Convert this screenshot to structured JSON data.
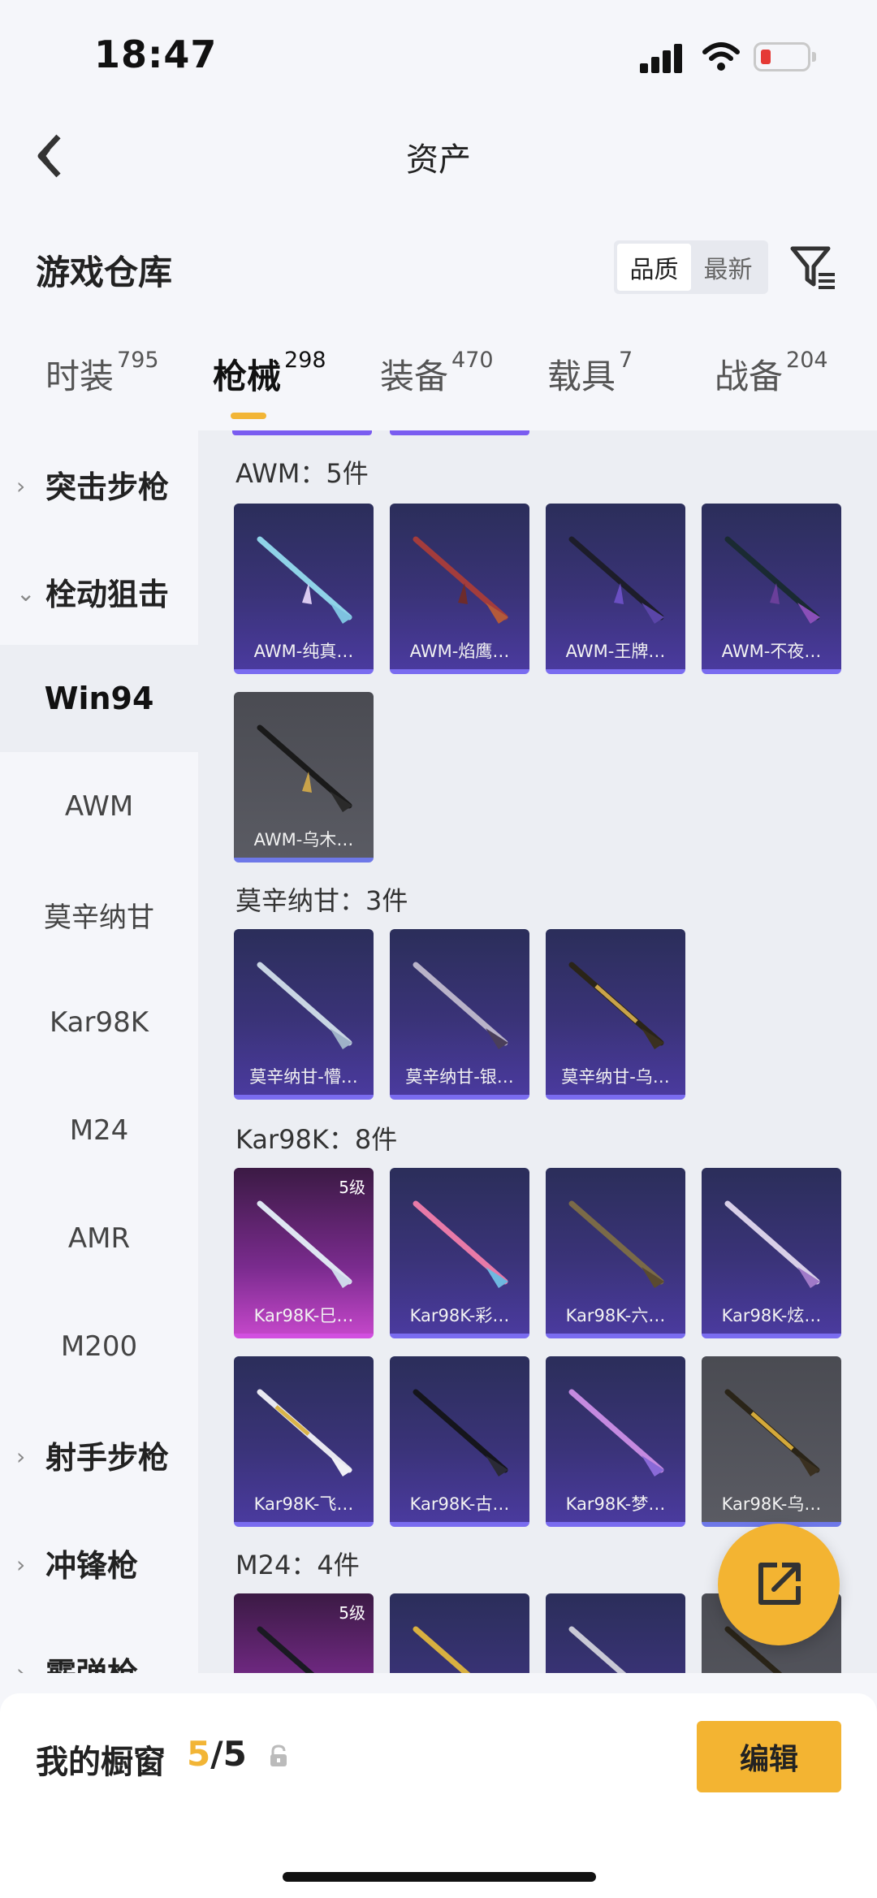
{
  "status_bar": {
    "time": "18:47"
  },
  "nav": {
    "title": "资产"
  },
  "header": {
    "title": "游戏仓库",
    "sort_options": [
      {
        "label": "品质",
        "active": true
      },
      {
        "label": "最新",
        "active": false
      }
    ]
  },
  "tabs": [
    {
      "label": "时装",
      "count": "795",
      "active": false
    },
    {
      "label": "枪械",
      "count": "298",
      "active": true
    },
    {
      "label": "装备",
      "count": "470",
      "active": false
    },
    {
      "label": "载具",
      "count": "7",
      "active": false
    },
    {
      "label": "战备",
      "count": "204",
      "active": false
    }
  ],
  "sidebar": {
    "items": [
      {
        "label": "突击步枪",
        "type": "group",
        "expanded": false
      },
      {
        "label": "栓动狙击",
        "type": "group",
        "expanded": true
      },
      {
        "label": "Win94",
        "type": "sub",
        "selected": true
      },
      {
        "label": "AWM",
        "type": "sub",
        "selected": false
      },
      {
        "label": "莫辛纳甘",
        "type": "sub",
        "selected": false
      },
      {
        "label": "Kar98K",
        "type": "sub",
        "selected": false
      },
      {
        "label": "M24",
        "type": "sub",
        "selected": false
      },
      {
        "label": "AMR",
        "type": "sub",
        "selected": false
      },
      {
        "label": "M200",
        "type": "sub",
        "selected": false
      },
      {
        "label": "射手步枪",
        "type": "group",
        "expanded": false
      },
      {
        "label": "冲锋枪",
        "type": "group",
        "expanded": false
      },
      {
        "label": "霰弹枪",
        "type": "group",
        "expanded": false
      }
    ]
  },
  "sections": [
    {
      "header": "AWM：5件",
      "items": [
        {
          "name": "AWM-纯真…",
          "style": "purple",
          "level": ""
        },
        {
          "name": "AWM-焰鹰…",
          "style": "purple",
          "level": ""
        },
        {
          "name": "AWM-王牌…",
          "style": "purple",
          "level": ""
        },
        {
          "name": "AWM-不夜…",
          "style": "purple",
          "level": ""
        },
        {
          "name": "AWM-乌木…",
          "style": "grey",
          "level": ""
        }
      ]
    },
    {
      "header": "莫辛纳甘：3件",
      "items": [
        {
          "name": "莫辛纳甘-懵…",
          "style": "purple",
          "level": ""
        },
        {
          "name": "莫辛纳甘-银…",
          "style": "purple",
          "level": ""
        },
        {
          "name": "莫辛纳甘-乌…",
          "style": "purple",
          "level": ""
        }
      ]
    },
    {
      "header": "Kar98K：8件",
      "items": [
        {
          "name": "Kar98K-巳…",
          "style": "pink",
          "level": "5级"
        },
        {
          "name": "Kar98K-彩…",
          "style": "purple",
          "level": ""
        },
        {
          "name": "Kar98K-六…",
          "style": "purple",
          "level": ""
        },
        {
          "name": "Kar98K-炫…",
          "style": "purple",
          "level": ""
        },
        {
          "name": "Kar98K-飞…",
          "style": "purple",
          "level": ""
        },
        {
          "name": "Kar98K-古…",
          "style": "purple",
          "level": ""
        },
        {
          "name": "Kar98K-梦…",
          "style": "purple",
          "level": ""
        },
        {
          "name": "Kar98K-乌…",
          "style": "grey",
          "level": ""
        }
      ]
    },
    {
      "header": "M24：4件",
      "items": [
        {
          "name": "",
          "style": "pink",
          "level": "5级"
        },
        {
          "name": "",
          "style": "purple",
          "level": ""
        },
        {
          "name": "",
          "style": "purple",
          "level": ""
        },
        {
          "name": "",
          "style": "grey",
          "level": ""
        }
      ]
    }
  ],
  "bottom_bar": {
    "label": "我的橱窗",
    "current": "5",
    "total": "/5",
    "edit_label": "编辑"
  },
  "icons": {
    "back": "chevron-left-icon",
    "filter": "filter-icon",
    "share": "share-icon",
    "lock": "lock-icon"
  },
  "colors": {
    "accent": "#f3b432",
    "card_purple": "#3a3378",
    "card_pink": "#c246c8",
    "card_grey": "#55565e"
  }
}
